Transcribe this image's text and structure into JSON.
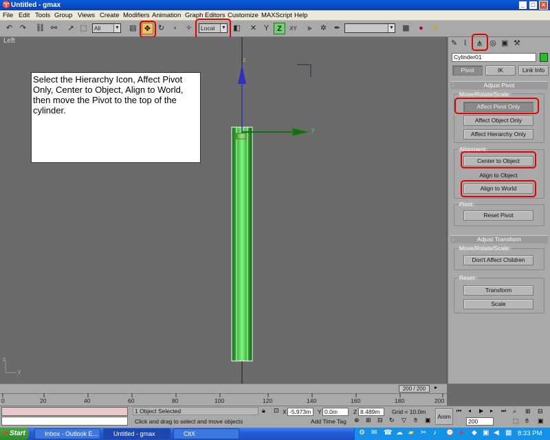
{
  "window": {
    "title": "Untitled - gmax",
    "minimize": "_",
    "maximize": "□",
    "close": "×"
  },
  "menu": [
    "File",
    "Edit",
    "Tools",
    "Group",
    "Views",
    "Create",
    "Modifiers",
    "Animation",
    "Graph Editors",
    "Customize",
    "MAXScript",
    "Help"
  ],
  "toolbar": {
    "selection_filter": "All",
    "coordinate_system": "Local",
    "named_selection": ""
  },
  "viewport": {
    "label": "Left",
    "callout": "Select the Hierarchy Icon, Affect Pivot Only, Center to Object, Align to World, then move the Pivot to the top of the cylinder.",
    "axis_z": "z",
    "axis_y": "y",
    "origin_axis_z": "z",
    "origin_axis_y": "y",
    "object_color": "#2eb82e"
  },
  "panel": {
    "object_name": "Cylinder01",
    "object_color": "#22c022",
    "tabs": [
      "Pivot",
      "IK",
      "Link Info"
    ],
    "adjust_pivot": {
      "title": "Adjust Pivot",
      "group_move": "Move/Rotate/Scale:",
      "affect_pivot_only": "Affect Pivot Only",
      "affect_object_only": "Affect Object Only",
      "affect_hierarchy_only": "Affect Hierarchy Only",
      "group_alignment": "Alignment:",
      "center_to_object": "Center to Object",
      "align_to_object": "Align to Object",
      "align_to_world": "Align to World",
      "group_pivot": "Pivot:",
      "reset_pivot": "Reset Pivot"
    },
    "adjust_transform": {
      "title": "Adjust Transform",
      "group_move": "Move/Rotate/Scale:",
      "dont_affect_children": "Don't Affect Children",
      "group_reset": "Reset:",
      "transform": "Transform",
      "scale": "Scale"
    }
  },
  "timeline": {
    "slider": "200 / 200",
    "ticks": [
      "0",
      "20",
      "40",
      "60",
      "80",
      "100",
      "120",
      "140",
      "160",
      "180",
      "200"
    ]
  },
  "status": {
    "selection": "1 Object Selected",
    "prompt": "Click and drag to select and move objects",
    "x_label": "X",
    "x": "-5.973m",
    "y_label": "Y",
    "y": "0.0m",
    "z_label": "Z",
    "z": "8.489m",
    "grid": "Grid = 10.0m",
    "add_time_tag": "Add Time Tag",
    "anim": "Anim",
    "frame": "200"
  },
  "taskbar": {
    "start": "Start",
    "tasks": [
      "Inbox - Outlook E...",
      "Untitled - gmax",
      "CitX"
    ],
    "clock": "8:33 PM"
  }
}
